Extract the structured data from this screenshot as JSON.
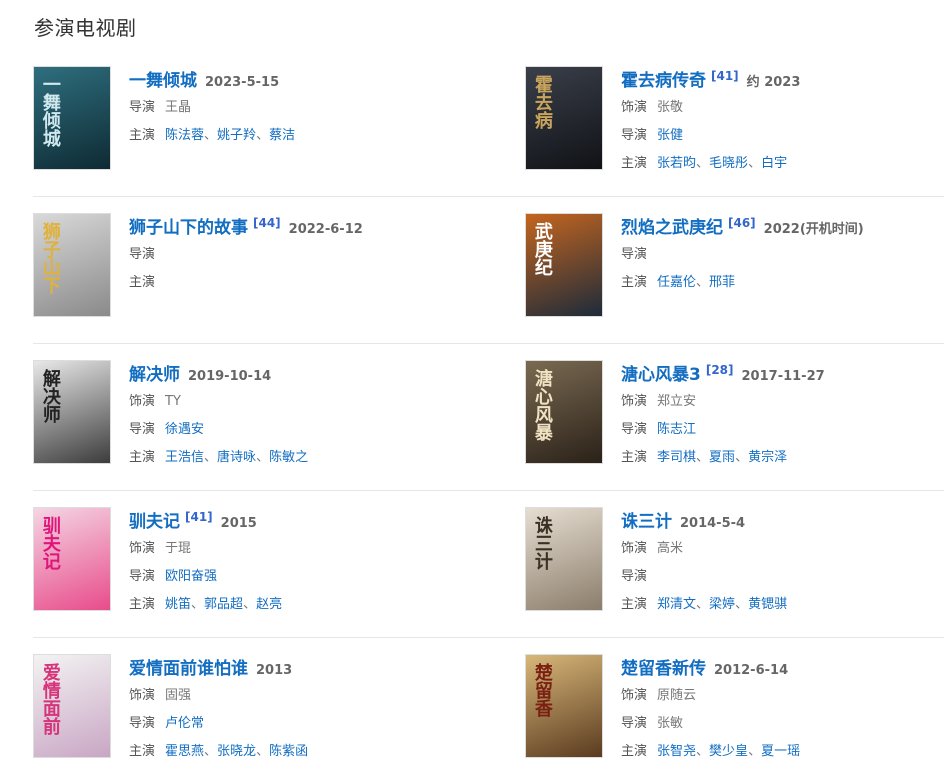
{
  "section": {
    "title": "参演电视剧"
  },
  "items": [
    {
      "title": "一舞倾城",
      "ref": "",
      "date": "2023-5-15",
      "role_label": "",
      "role": "",
      "director_label": "导演",
      "director": "王晶",
      "director_linked": false,
      "cast_label": "主演",
      "cast": [
        "陈法蓉",
        "姚子羚",
        "蔡洁"
      ],
      "poster": {
        "bg1": "#2f6f7f",
        "bg2": "#0e2a33",
        "text": "一舞倾城",
        "text_color": "#cfe9ef"
      }
    },
    {
      "title": "霍去病传奇",
      "ref": "[41]",
      "date": "约 2023",
      "role_label": "饰演",
      "role": "张敬",
      "director_label": "导演",
      "director": "张健",
      "director_linked": true,
      "cast_label": "主演",
      "cast": [
        "张若昀",
        "毛晓彤",
        "白宇"
      ],
      "poster": {
        "bg1": "#3a3f4a",
        "bg2": "#101216",
        "text": "霍去病",
        "text_color": "#c9a45c"
      }
    },
    {
      "title": "狮子山下的故事",
      "ref": "[44]",
      "date": "2022-6-12",
      "role_label": "",
      "role": "",
      "director_label": "导演",
      "director": "",
      "director_linked": false,
      "cast_label": "主演",
      "cast": [],
      "poster": {
        "bg1": "#d9d9d9",
        "bg2": "#8a8a8a",
        "text": "狮子山下",
        "text_color": "#e0b13b"
      }
    },
    {
      "title": "烈焰之武庚纪",
      "ref": "[46]",
      "date": "2022(开机时间)",
      "role_label": "",
      "role": "",
      "director_label": "导演",
      "director": "",
      "director_linked": false,
      "cast_label": "主演",
      "cast": [
        "任嘉伦",
        "邢菲"
      ],
      "poster": {
        "bg1": "#c4651f",
        "bg2": "#1d2b3a",
        "text": "武庚纪",
        "text_color": "#ffffff"
      }
    },
    {
      "title": "解决师",
      "ref": "",
      "date": "2019-10-14",
      "role_label": "饰演",
      "role": "TY",
      "director_label": "导演",
      "director": "徐遇安",
      "director_linked": true,
      "cast_label": "主演",
      "cast": [
        "王浩信",
        "唐诗咏",
        "陈敏之"
      ],
      "poster": {
        "bg1": "#e8e8e8",
        "bg2": "#3c3c3c",
        "text": "解决师",
        "text_color": "#222222"
      }
    },
    {
      "title": "溏心风暴3",
      "ref": "[28]",
      "date": "2017-11-27",
      "role_label": "饰演",
      "role": "郑立安",
      "director_label": "导演",
      "director": "陈志江",
      "director_linked": true,
      "cast_label": "主演",
      "cast": [
        "李司棋",
        "夏雨",
        "黄宗泽"
      ],
      "poster": {
        "bg1": "#7a6a52",
        "bg2": "#2a2118",
        "text": "溏心风暴",
        "text_color": "#f0e3c4"
      }
    },
    {
      "title": "驯夫记",
      "ref": "[41]",
      "date": "2015",
      "role_label": "饰演",
      "role": "于琨",
      "director_label": "导演",
      "director": "欧阳奋强",
      "director_linked": true,
      "cast_label": "主演",
      "cast": [
        "姚笛",
        "郭品超",
        "赵亮"
      ],
      "poster": {
        "bg1": "#f4d6e4",
        "bg2": "#e84c8b",
        "text": "驯夫记",
        "text_color": "#e0157a"
      }
    },
    {
      "title": "诛三计",
      "ref": "",
      "date": "2014-5-4",
      "role_label": "饰演",
      "role": "高米",
      "director_label": "导演",
      "director": "",
      "director_linked": false,
      "cast_label": "主演",
      "cast": [
        "郑清文",
        "梁婷",
        "黄锶骐"
      ],
      "poster": {
        "bg1": "#e6ded2",
        "bg2": "#8b7d6b",
        "text": "诛三计",
        "text_color": "#3b3024"
      }
    },
    {
      "title": "爱情面前谁怕谁",
      "ref": "",
      "date": "2013",
      "role_label": "饰演",
      "role": "固强",
      "director_label": "导演",
      "director": "卢伦常",
      "director_linked": true,
      "cast_label": "主演",
      "cast": [
        "霍思燕",
        "张晓龙",
        "陈紫函"
      ],
      "poster": {
        "bg1": "#f3f3f3",
        "bg2": "#c9a6c4",
        "text": "爱情面前",
        "text_color": "#d6337a"
      }
    },
    {
      "title": "楚留香新传",
      "ref": "",
      "date": "2012-6-14",
      "role_label": "饰演",
      "role": "原随云",
      "director_label": "导演",
      "director": "张敏",
      "director_linked": false,
      "cast_label": "主演",
      "cast": [
        "张智尧",
        "樊少皇",
        "夏一瑶"
      ],
      "poster": {
        "bg1": "#d8b779",
        "bg2": "#5a3b1f",
        "text": "楚留香",
        "text_color": "#7a1f12"
      }
    }
  ]
}
